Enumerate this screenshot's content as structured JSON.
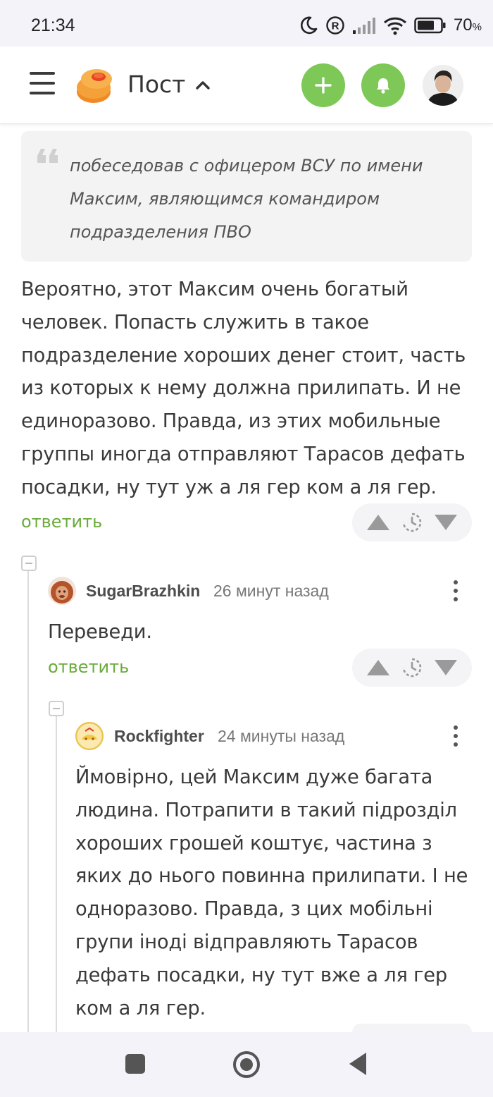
{
  "status_bar": {
    "time": "21:34",
    "battery_percent": "70",
    "battery_unit": "%",
    "icons": [
      "moon-icon",
      "registered-icon",
      "signal-icon",
      "wifi-icon",
      "battery-icon"
    ]
  },
  "header": {
    "title": "Пост",
    "icons": [
      "menu-icon",
      "logo",
      "chevron-up-icon",
      "plus-icon",
      "bell-icon",
      "avatar"
    ]
  },
  "post": {
    "quote": "побеседовав с офицером ВСУ по имени Максим, являющимся командиром подразделения ПВО",
    "text": "Вероятно, этот Максим очень богатый человек. Попасть служить в такое подразделение хороших денег стоит, часть из которых к нему должна прилипать. И не единоразово. Правда, из этих мобильные группы иногда отправляют Тарасов дефать посадки, ну тут уж а ля гер ком а ля гер.",
    "reply_label": "ответить"
  },
  "comments": [
    {
      "author": "SugarBrazhkin",
      "time": "26 минут назад",
      "text": "Переведи.",
      "reply_label": "ответить"
    },
    {
      "author": "Rockfighter",
      "time": "24 минуты назад",
      "text": "Ймовірно, цей Максим дуже багата людина. Потрапити в такий підрозділ хороших грошей коштує, частина з яких до нього повинна прилипати. І не одноразово. Правда, з цих мобільні групи іноді відправляють Тарасов дефать посадки, ну тут вже а ля гер ком а ля гер."
    }
  ],
  "colors": {
    "accent_green": "#7dc856",
    "link_green": "#6aab3a",
    "logo_orange": "#f08a24"
  }
}
